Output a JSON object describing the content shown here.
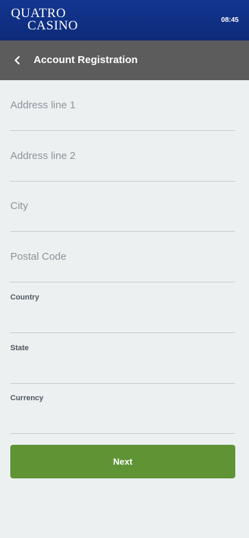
{
  "status_bar": {
    "brand_line1": "QUATRO",
    "brand_line2": "CASINO",
    "time": "08:45",
    "brand_color": "#13358f"
  },
  "header": {
    "title": "Account Registration",
    "back_icon": "chevron-left-icon",
    "background_color": "#5b5c5b"
  },
  "form": {
    "address_line_1": {
      "placeholder": "Address line 1",
      "value": ""
    },
    "address_line_2": {
      "placeholder": "Address line 2",
      "value": ""
    },
    "city": {
      "placeholder": "City",
      "value": ""
    },
    "postal_code": {
      "placeholder": "Postal Code",
      "value": ""
    },
    "country": {
      "label": "Country",
      "value": ""
    },
    "state": {
      "label": "State",
      "value": ""
    },
    "currency": {
      "label": "Currency",
      "value": ""
    }
  },
  "actions": {
    "next_label": "Next",
    "next_color": "#5f9334"
  }
}
